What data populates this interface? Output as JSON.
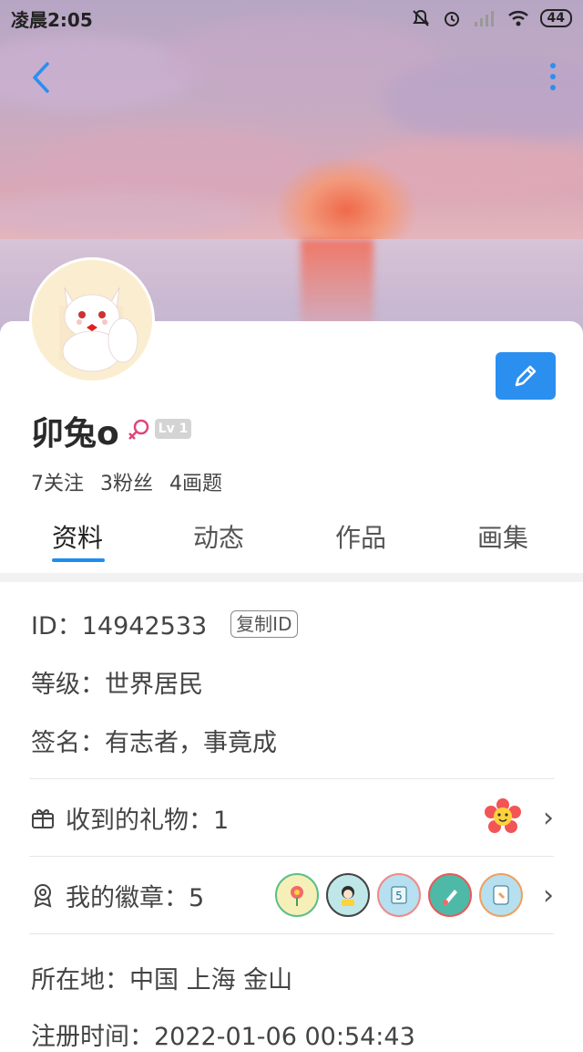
{
  "status_bar": {
    "time": "凌晨2:05",
    "battery": "44"
  },
  "profile": {
    "nickname": "卯兔o",
    "level": "Lv 1",
    "follow_count": "7关注",
    "fans_count": "3粉丝",
    "works_count": "4画题"
  },
  "tabs": [
    {
      "label": "资料",
      "active": true
    },
    {
      "label": "动态",
      "active": false
    },
    {
      "label": "作品",
      "active": false
    },
    {
      "label": "画集",
      "active": false
    }
  ],
  "info": {
    "id_line": "ID：14942533",
    "copy_label": "复制ID",
    "level_line": "等级：世界居民",
    "signature_line": "签名：有志者，事竟成",
    "gifts_label": "收到的礼物：1",
    "badges_label": "我的徽章：5",
    "location_line": "所在地：中国 上海 金山",
    "register_line": "注册时间：2022-01-06 00:54:43"
  },
  "colors": {
    "accent": "#2b8ff0",
    "tab_underline": "#1f8df0",
    "gender": "#e0457a"
  },
  "icons": [
    "back-icon",
    "more-icon",
    "edit-icon",
    "gift-icon",
    "badge-icon",
    "chevron-right-icon"
  ]
}
